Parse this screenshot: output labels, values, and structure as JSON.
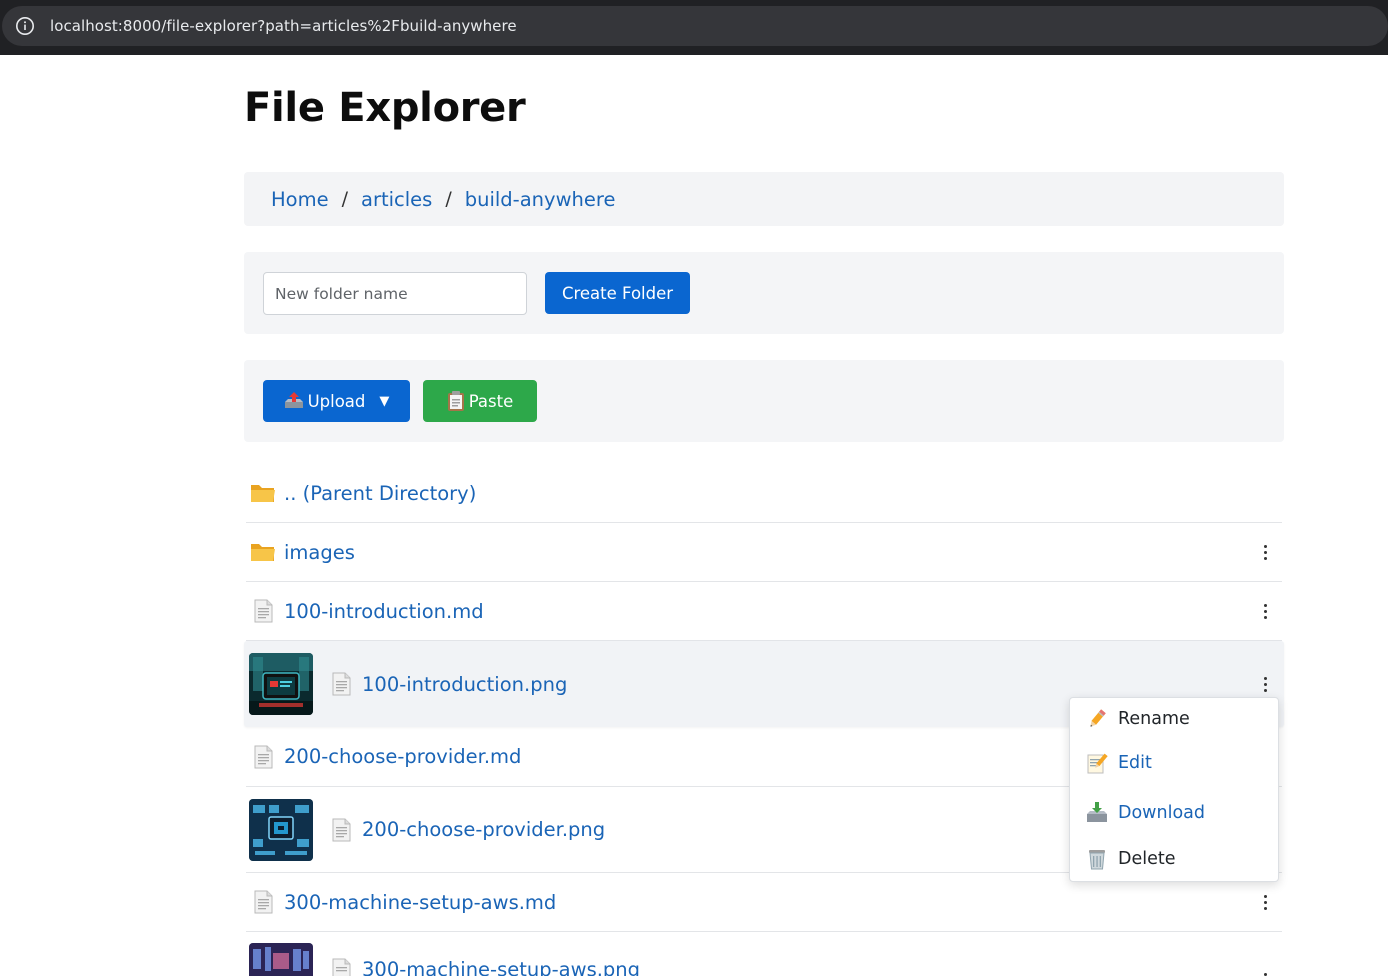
{
  "browser": {
    "url": "localhost:8000/file-explorer?path=articles%2Fbuild-anywhere"
  },
  "page": {
    "title": "File Explorer"
  },
  "breadcrumb": {
    "items": [
      "Home",
      "articles",
      "build-anywhere"
    ],
    "separator": "/"
  },
  "create_folder": {
    "placeholder": "New folder name",
    "button_label": "Create Folder"
  },
  "actions": {
    "upload_label": "Upload",
    "upload_caret": "▼",
    "paste_label": "Paste"
  },
  "files": [
    {
      "name": ".. (Parent Directory)",
      "type": "folder",
      "menu": false
    },
    {
      "name": "images",
      "type": "folder",
      "menu": true
    },
    {
      "name": "100-introduction.md",
      "type": "file",
      "menu": true
    },
    {
      "name": "100-introduction.png",
      "type": "image",
      "menu": true,
      "highlighted": true
    },
    {
      "name": "200-choose-provider.md",
      "type": "file",
      "menu": false
    },
    {
      "name": "200-choose-provider.png",
      "type": "image",
      "menu": false
    },
    {
      "name": "300-machine-setup-aws.md",
      "type": "file",
      "menu": true
    },
    {
      "name": "300-machine-setup-aws.png",
      "type": "image",
      "menu": true
    }
  ],
  "context_menu": {
    "items": [
      {
        "label": "Rename",
        "icon": "pencil-icon"
      },
      {
        "label": "Edit",
        "icon": "memo-icon"
      },
      {
        "label": "Download",
        "icon": "inbox-tray-icon"
      },
      {
        "label": "Delete",
        "icon": "wastebasket-icon"
      }
    ]
  },
  "colors": {
    "link": "#1a64b6",
    "primary_button": "#0a66d0",
    "success_button": "#2da84a",
    "panel_bg": "#f4f5f7"
  }
}
